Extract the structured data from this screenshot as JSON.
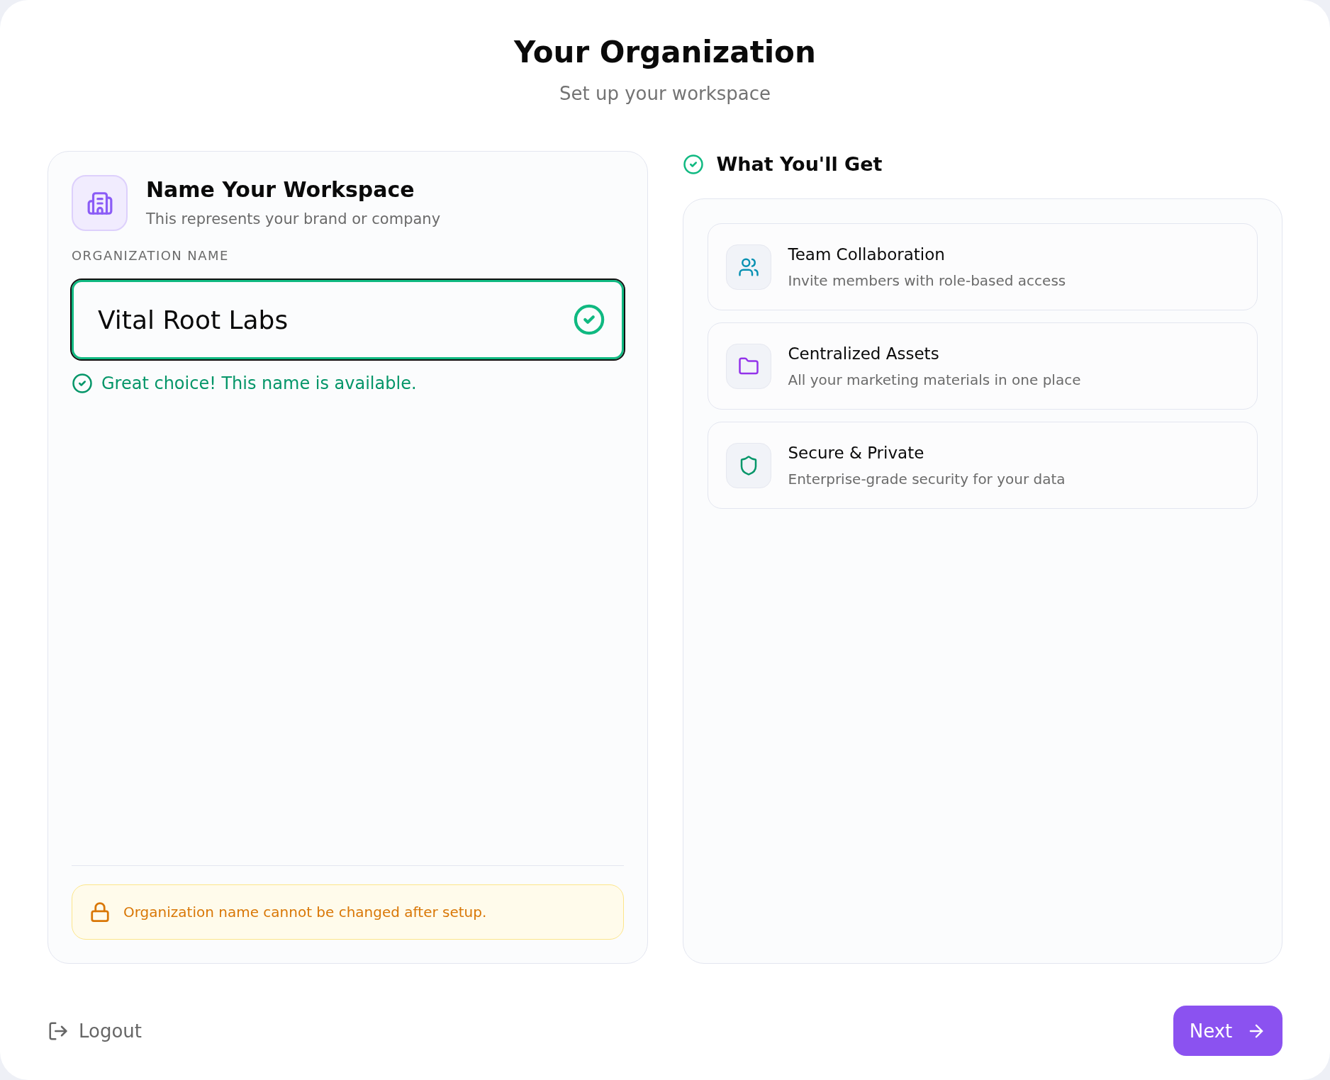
{
  "header": {
    "title": "Your Organization",
    "subtitle": "Set up your workspace"
  },
  "workspace": {
    "title": "Name Your Workspace",
    "subtitle": "This represents your brand or company",
    "field": {
      "label": "ORGANIZATION NAME",
      "value": "Vital Root Labs",
      "valid": true
    },
    "message": "Great choice! This name is available.",
    "notice": "Organization name cannot be changed after setup."
  },
  "benefits": {
    "title": "What You'll Get",
    "items": [
      {
        "title": "Team Collaboration",
        "description": "Invite members with role-based access",
        "color": "#0891b2"
      },
      {
        "title": "Centralized Assets",
        "description": "All your marketing materials in one place",
        "color": "#9333ea"
      },
      {
        "title": "Secure & Private",
        "description": "Enterprise-grade security for your data",
        "color": "#059669"
      }
    ]
  },
  "footer": {
    "logout": "Logout",
    "next": "Next"
  }
}
